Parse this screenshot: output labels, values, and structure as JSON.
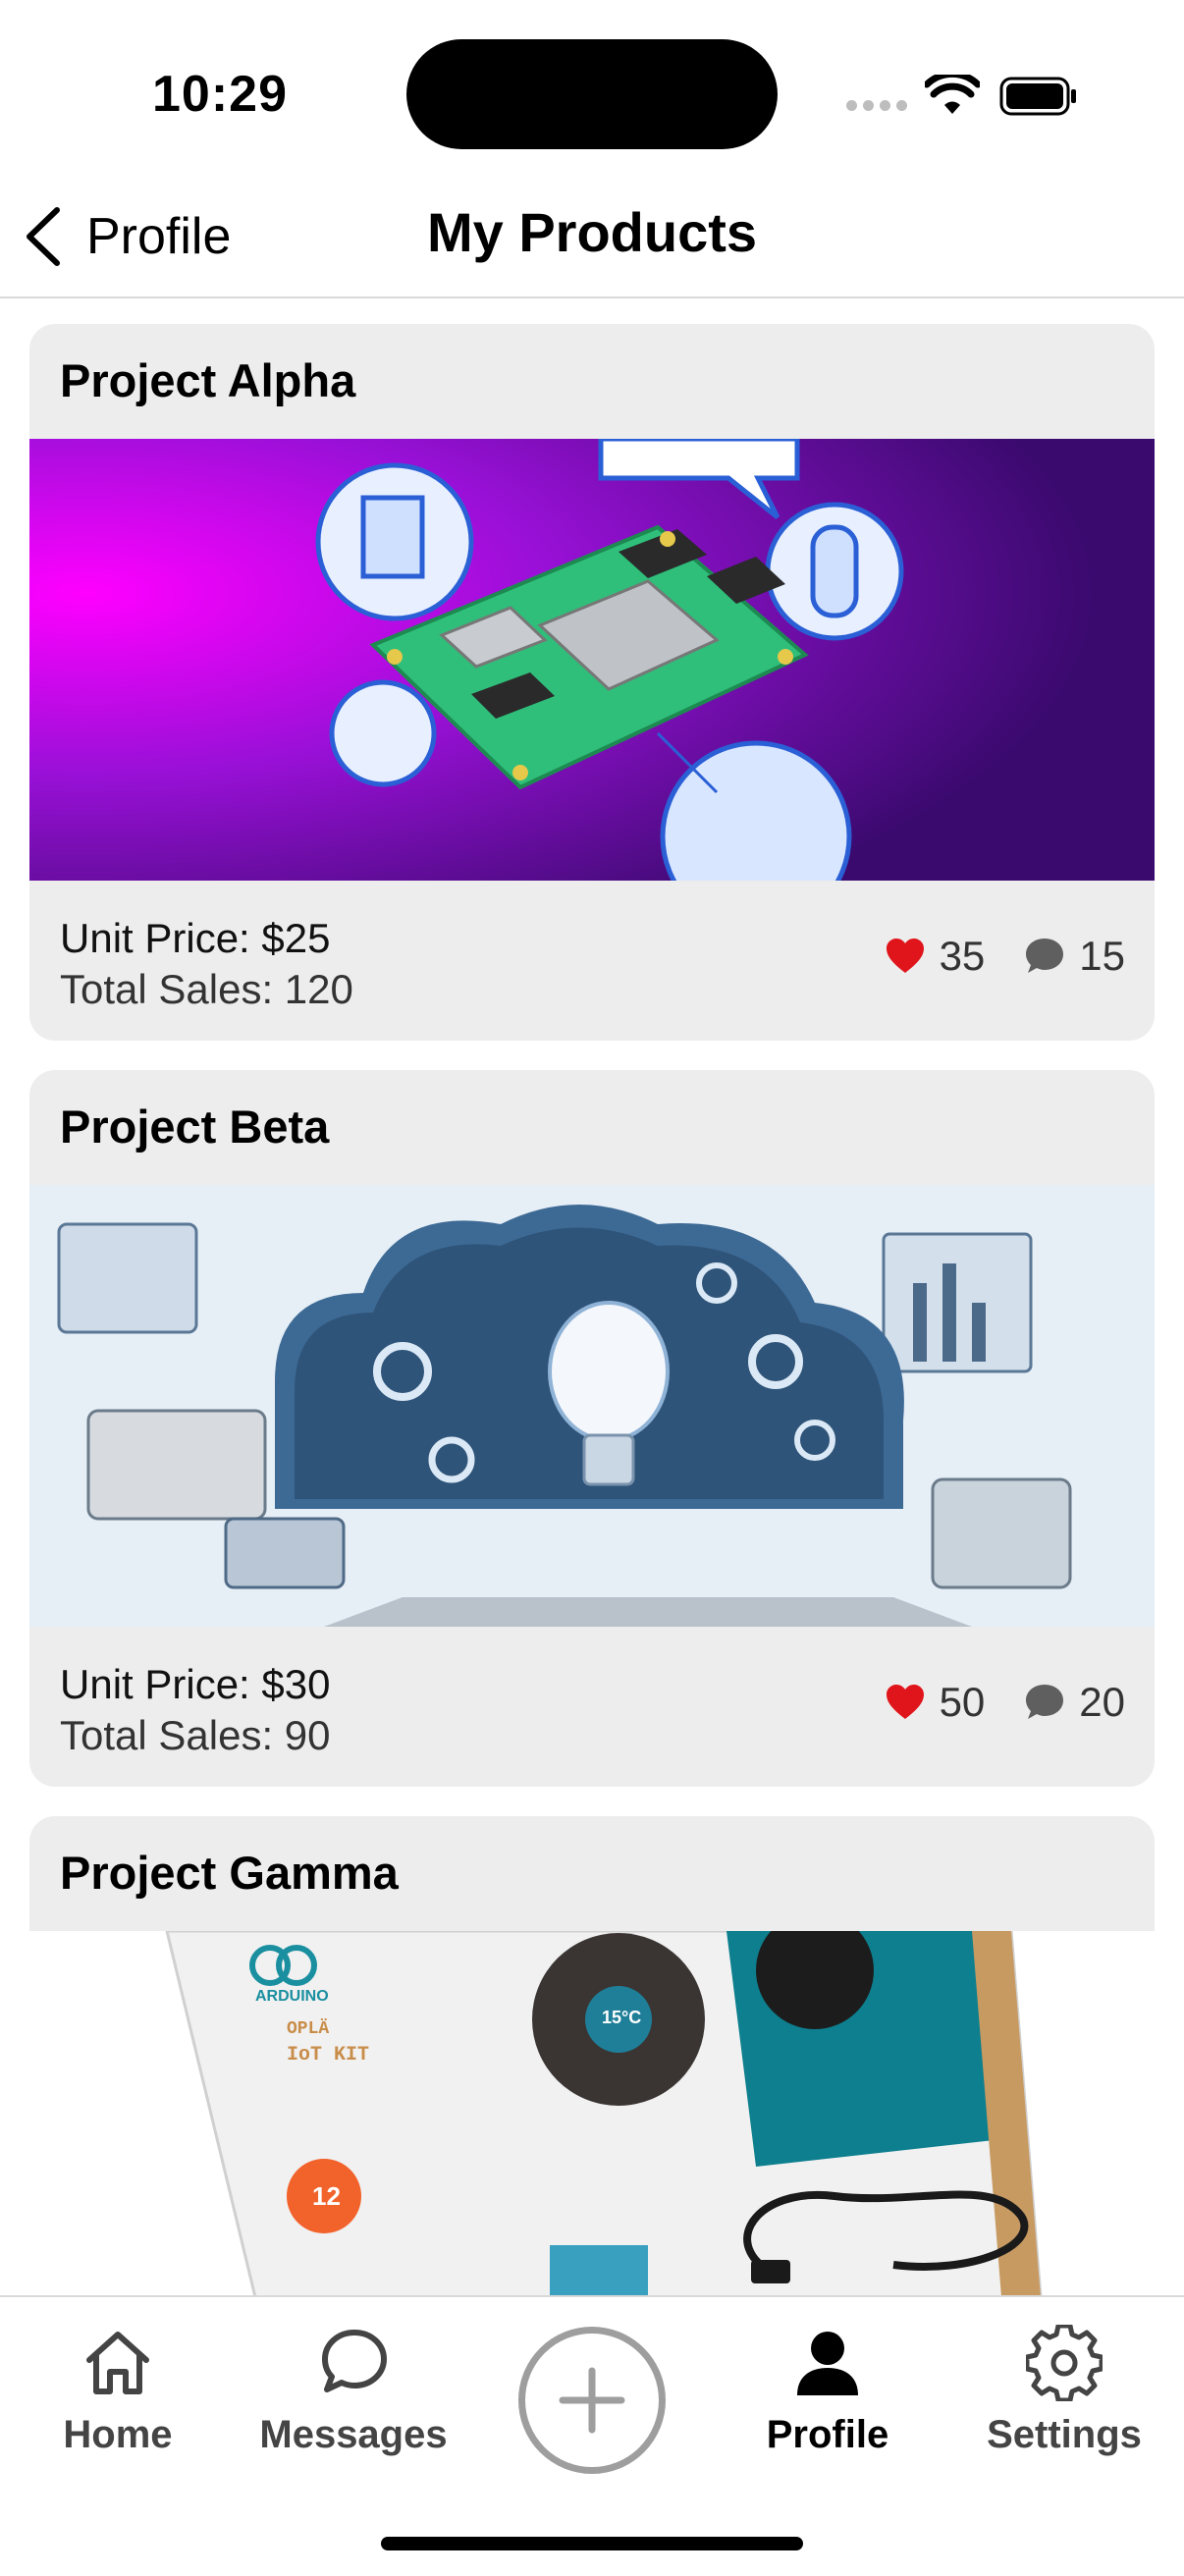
{
  "status": {
    "time": "10:29"
  },
  "nav": {
    "back_label": "Profile",
    "title": "My Products"
  },
  "products": [
    {
      "name": "Project Alpha",
      "unit_price": "Unit Price: $25",
      "total_sales": "Total Sales: 120",
      "likes": "35",
      "comments": "15"
    },
    {
      "name": "Project Beta",
      "unit_price": "Unit Price: $30",
      "total_sales": "Total Sales: 90",
      "likes": "50",
      "comments": "20"
    },
    {
      "name": "Project Gamma"
    }
  ],
  "gamma_image_text": {
    "brand": "ARDUINO",
    "kit_line1": "OPLÄ",
    "kit_line2": "IoT KIT",
    "temp": "15°C",
    "badge": "12"
  },
  "tabs": [
    {
      "label": "Home",
      "icon": "home-icon"
    },
    {
      "label": "Messages",
      "icon": "chat-bubble-icon"
    },
    {
      "label": "",
      "icon": "add-circle-icon"
    },
    {
      "label": "Profile",
      "icon": "person-icon",
      "active": true
    },
    {
      "label": "Settings",
      "icon": "gear-icon"
    }
  ],
  "colors": {
    "heart": "#e0151b",
    "card_bg": "#ededed",
    "accent_alpha": "#c000ff"
  }
}
